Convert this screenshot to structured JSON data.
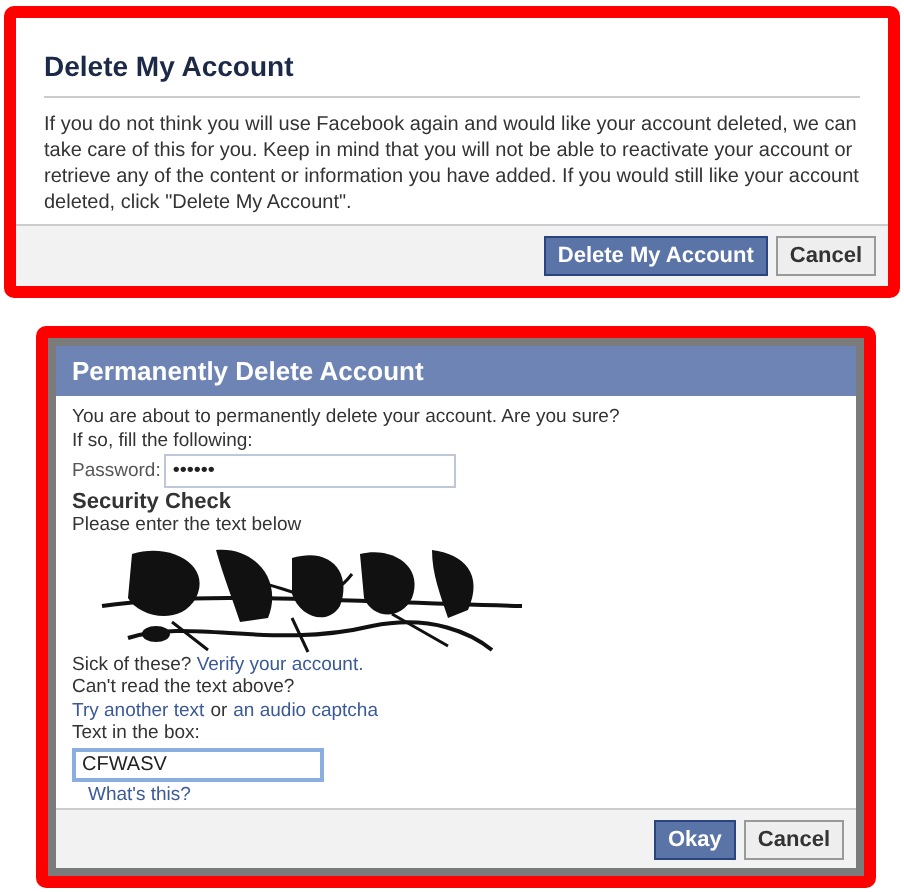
{
  "delete_dialog": {
    "title": "Delete My Account",
    "message": "If you do not think you will use Facebook again and would like your account deleted, we can take care of this for you. Keep in mind that you will not be able to reactivate your account or retrieve any of the content or information you have added. If you would still like your account deleted, click \"Delete My Account\".",
    "buttons": [
      {
        "label": "Delete My Account",
        "kind": "primary"
      },
      {
        "label": "Cancel",
        "kind": "secondary"
      }
    ]
  },
  "confirm_dialog": {
    "title": "Permanently Delete Account",
    "intro": [
      "You are about to permanently delete your account. Are you sure?",
      "If so, fill the following:"
    ],
    "password": {
      "label": "Password:",
      "value": "••••••"
    },
    "security_heading": "Security Check",
    "security_hint": "Please enter the text below",
    "verify": {
      "text": "Sick of these?",
      "link": "Verify your account."
    },
    "cant_read": "Can't read the text above?",
    "alternatives": {
      "link1": "Try another text",
      "middle": "or",
      "link2": "an audio captcha"
    },
    "answer": {
      "label": "Text in the box:",
      "value": "CFWASV",
      "focused": true
    },
    "help_link": "What's this?",
    "buttons": [
      {
        "label": "Okay",
        "kind": "primary"
      },
      {
        "label": "Cancel",
        "kind": "secondary"
      }
    ]
  }
}
